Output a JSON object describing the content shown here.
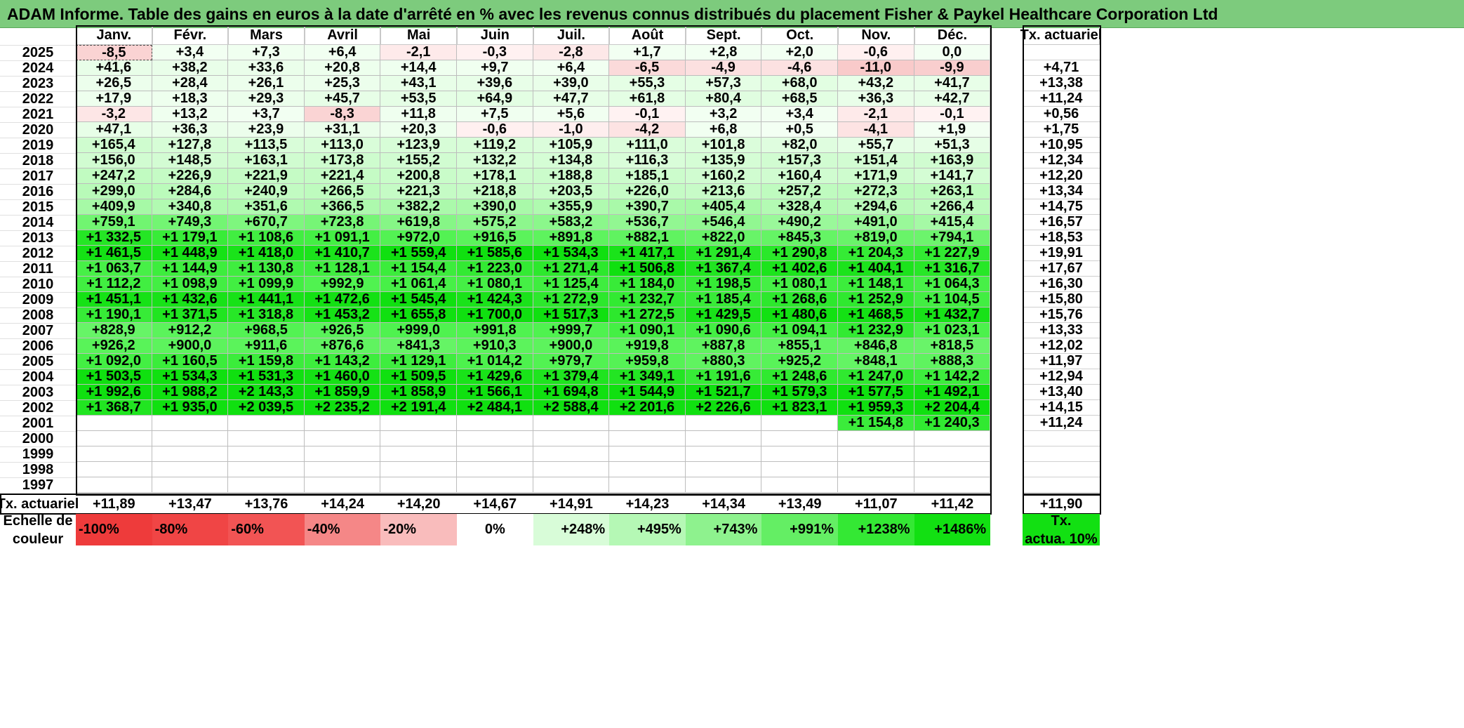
{
  "title": "ADAM Informe. Table des gains en euros à la date d'arrêté en % avec les revenus connus distribués du placement Fisher & Paykel Healthcare Corporation Ltd",
  "months": [
    "Janv.",
    "Févr.",
    "Mars",
    "Avril",
    "Mai",
    "Juin",
    "Juil.",
    "Août",
    "Sept.",
    "Oct.",
    "Nov.",
    "Déc."
  ],
  "actuarial_header": "Tx. actuariel",
  "rows": [
    {
      "year": "2025",
      "values": [
        "-8,5",
        "+3,4",
        "+7,3",
        "+6,4",
        "-2,1",
        "-0,3",
        "-2,8",
        "+1,7",
        "+2,8",
        "+2,0",
        "-0,6",
        "0,0"
      ],
      "actuarial": ""
    },
    {
      "year": "2024",
      "values": [
        "+41,6",
        "+38,2",
        "+33,6",
        "+20,8",
        "+14,4",
        "+9,7",
        "+6,4",
        "-6,5",
        "-4,9",
        "-4,6",
        "-11,0",
        "-9,9"
      ],
      "actuarial": "+4,71"
    },
    {
      "year": "2023",
      "values": [
        "+26,5",
        "+28,4",
        "+26,1",
        "+25,3",
        "+43,1",
        "+39,6",
        "+39,0",
        "+55,3",
        "+57,3",
        "+68,0",
        "+43,2",
        "+41,7"
      ],
      "actuarial": "+13,38"
    },
    {
      "year": "2022",
      "values": [
        "+17,9",
        "+18,3",
        "+29,3",
        "+45,7",
        "+53,5",
        "+64,9",
        "+47,7",
        "+61,8",
        "+80,4",
        "+68,5",
        "+36,3",
        "+42,7"
      ],
      "actuarial": "+11,24"
    },
    {
      "year": "2021",
      "values": [
        "-3,2",
        "+13,2",
        "+3,7",
        "-8,3",
        "+11,8",
        "+7,5",
        "+5,6",
        "-0,1",
        "+3,2",
        "+3,4",
        "-2,1",
        "-0,1"
      ],
      "actuarial": "+0,56"
    },
    {
      "year": "2020",
      "values": [
        "+47,1",
        "+36,3",
        "+23,9",
        "+31,1",
        "+20,3",
        "-0,6",
        "-1,0",
        "-4,2",
        "+6,8",
        "+0,5",
        "-4,1",
        "+1,9"
      ],
      "actuarial": "+1,75"
    },
    {
      "year": "2019",
      "values": [
        "+165,4",
        "+127,8",
        "+113,5",
        "+113,0",
        "+123,9",
        "+119,2",
        "+105,9",
        "+111,0",
        "+101,8",
        "+82,0",
        "+55,7",
        "+51,3"
      ],
      "actuarial": "+10,95"
    },
    {
      "year": "2018",
      "values": [
        "+156,0",
        "+148,5",
        "+163,1",
        "+173,8",
        "+155,2",
        "+132,2",
        "+134,8",
        "+116,3",
        "+135,9",
        "+157,3",
        "+151,4",
        "+163,9"
      ],
      "actuarial": "+12,34"
    },
    {
      "year": "2017",
      "values": [
        "+247,2",
        "+226,9",
        "+221,9",
        "+221,4",
        "+200,8",
        "+178,1",
        "+188,8",
        "+185,1",
        "+160,2",
        "+160,4",
        "+171,9",
        "+141,7"
      ],
      "actuarial": "+12,20"
    },
    {
      "year": "2016",
      "values": [
        "+299,0",
        "+284,6",
        "+240,9",
        "+266,5",
        "+221,3",
        "+218,8",
        "+203,5",
        "+226,0",
        "+213,6",
        "+257,2",
        "+272,3",
        "+263,1"
      ],
      "actuarial": "+13,34"
    },
    {
      "year": "2015",
      "values": [
        "+409,9",
        "+340,8",
        "+351,6",
        "+366,5",
        "+382,2",
        "+390,0",
        "+355,9",
        "+390,7",
        "+405,4",
        "+328,4",
        "+294,6",
        "+266,4"
      ],
      "actuarial": "+14,75"
    },
    {
      "year": "2014",
      "values": [
        "+759,1",
        "+749,3",
        "+670,7",
        "+723,8",
        "+619,8",
        "+575,2",
        "+583,2",
        "+536,7",
        "+546,4",
        "+490,2",
        "+491,0",
        "+415,4"
      ],
      "actuarial": "+16,57"
    },
    {
      "year": "2013",
      "values": [
        "+1 332,5",
        "+1 179,1",
        "+1 108,6",
        "+1 091,1",
        "+972,0",
        "+916,5",
        "+891,8",
        "+882,1",
        "+822,0",
        "+845,3",
        "+819,0",
        "+794,1"
      ],
      "actuarial": "+18,53"
    },
    {
      "year": "2012",
      "values": [
        "+1 461,5",
        "+1 448,9",
        "+1 418,0",
        "+1 410,7",
        "+1 559,4",
        "+1 585,6",
        "+1 534,3",
        "+1 417,1",
        "+1 291,4",
        "+1 290,8",
        "+1 204,3",
        "+1 227,9"
      ],
      "actuarial": "+19,91"
    },
    {
      "year": "2011",
      "values": [
        "+1 063,7",
        "+1 144,9",
        "+1 130,8",
        "+1 128,1",
        "+1 154,4",
        "+1 223,0",
        "+1 271,4",
        "+1 506,8",
        "+1 367,4",
        "+1 402,6",
        "+1 404,1",
        "+1 316,7"
      ],
      "actuarial": "+17,67"
    },
    {
      "year": "2010",
      "values": [
        "+1 112,2",
        "+1 098,9",
        "+1 099,9",
        "+992,9",
        "+1 061,4",
        "+1 080,1",
        "+1 125,4",
        "+1 184,0",
        "+1 198,5",
        "+1 080,1",
        "+1 148,1",
        "+1 064,3"
      ],
      "actuarial": "+16,30"
    },
    {
      "year": "2009",
      "values": [
        "+1 451,1",
        "+1 432,6",
        "+1 441,1",
        "+1 472,6",
        "+1 545,4",
        "+1 424,3",
        "+1 272,9",
        "+1 232,7",
        "+1 185,4",
        "+1 268,6",
        "+1 252,9",
        "+1 104,5"
      ],
      "actuarial": "+15,80"
    },
    {
      "year": "2008",
      "values": [
        "+1 190,1",
        "+1 371,5",
        "+1 318,8",
        "+1 453,2",
        "+1 655,8",
        "+1 700,0",
        "+1 517,3",
        "+1 272,5",
        "+1 429,5",
        "+1 480,6",
        "+1 468,5",
        "+1 432,7"
      ],
      "actuarial": "+15,76"
    },
    {
      "year": "2007",
      "values": [
        "+828,9",
        "+912,2",
        "+968,5",
        "+926,5",
        "+999,0",
        "+991,8",
        "+999,7",
        "+1 090,1",
        "+1 090,6",
        "+1 094,1",
        "+1 232,9",
        "+1 023,1"
      ],
      "actuarial": "+13,33"
    },
    {
      "year": "2006",
      "values": [
        "+926,2",
        "+900,0",
        "+911,6",
        "+876,6",
        "+841,3",
        "+910,3",
        "+900,0",
        "+919,8",
        "+887,8",
        "+855,1",
        "+846,8",
        "+818,5"
      ],
      "actuarial": "+12,02"
    },
    {
      "year": "2005",
      "values": [
        "+1 092,0",
        "+1 160,5",
        "+1 159,8",
        "+1 143,2",
        "+1 129,1",
        "+1 014,2",
        "+979,7",
        "+959,8",
        "+880,3",
        "+925,2",
        "+848,1",
        "+888,3"
      ],
      "actuarial": "+11,97"
    },
    {
      "year": "2004",
      "values": [
        "+1 503,5",
        "+1 534,3",
        "+1 531,3",
        "+1 460,0",
        "+1 509,5",
        "+1 429,6",
        "+1 379,4",
        "+1 349,1",
        "+1 191,6",
        "+1 248,6",
        "+1 247,0",
        "+1 142,2"
      ],
      "actuarial": "+12,94"
    },
    {
      "year": "2003",
      "values": [
        "+1 992,6",
        "+1 988,2",
        "+2 143,3",
        "+1 859,9",
        "+1 858,9",
        "+1 566,1",
        "+1 694,8",
        "+1 544,9",
        "+1 521,7",
        "+1 579,3",
        "+1 577,5",
        "+1 492,1"
      ],
      "actuarial": "+13,40"
    },
    {
      "year": "2002",
      "values": [
        "+1 368,7",
        "+1 935,0",
        "+2 039,5",
        "+2 235,2",
        "+2 191,4",
        "+2 484,1",
        "+2 588,4",
        "+2 201,6",
        "+2 226,6",
        "+1 823,1",
        "+1 959,3",
        "+2 204,4"
      ],
      "actuarial": "+14,15"
    },
    {
      "year": "2001",
      "values": [
        "",
        "",
        "",
        "",
        "",
        "",
        "",
        "",
        "",
        "",
        "+1 154,8",
        "+1 240,3"
      ],
      "actuarial": "+11,24"
    },
    {
      "year": "2000",
      "values": [
        "",
        "",
        "",
        "",
        "",
        "",
        "",
        "",
        "",
        "",
        "",
        ""
      ],
      "actuarial": ""
    },
    {
      "year": "1999",
      "values": [
        "",
        "",
        "",
        "",
        "",
        "",
        "",
        "",
        "",
        "",
        "",
        ""
      ],
      "actuarial": ""
    },
    {
      "year": "1998",
      "values": [
        "",
        "",
        "",
        "",
        "",
        "",
        "",
        "",
        "",
        "",
        "",
        ""
      ],
      "actuarial": ""
    },
    {
      "year": "1997",
      "values": [
        "",
        "",
        "",
        "",
        "",
        "",
        "",
        "",
        "",
        "",
        "",
        ""
      ],
      "actuarial": ""
    }
  ],
  "footer": {
    "label": "Tx. actuariel",
    "values": [
      "+11,89",
      "+13,47",
      "+13,76",
      "+14,24",
      "+14,20",
      "+14,67",
      "+14,91",
      "+14,23",
      "+14,34",
      "+13,49",
      "+11,07",
      "+11,42"
    ],
    "total": "+11,90"
  },
  "legend": {
    "label_line1": "Echelle de",
    "label_line2": "couleur",
    "scale": [
      {
        "text": "-100%",
        "color": "#ee3b3b"
      },
      {
        "text": "-80%",
        "color": "#f04545"
      },
      {
        "text": "-60%",
        "color": "#f25454"
      },
      {
        "text": "-40%",
        "color": "#f58787"
      },
      {
        "text": "-20%",
        "color": "#f9bcbc"
      },
      {
        "text": "0%",
        "color": "#ffffff"
      },
      {
        "text": "+248%",
        "color": "#d8fcd8"
      },
      {
        "text": "+495%",
        "color": "#b5f8b5"
      },
      {
        "text": "+743%",
        "color": "#8ef28e"
      },
      {
        "text": "+991%",
        "color": "#64ee64"
      },
      {
        "text": "+1238%",
        "color": "#34e834"
      },
      {
        "text": "+1486%",
        "color": "#12e012"
      }
    ],
    "actuarial_line1": "Tx.",
    "actuarial_line2": "actua. 10%",
    "actuarial_color": "#12e012"
  }
}
